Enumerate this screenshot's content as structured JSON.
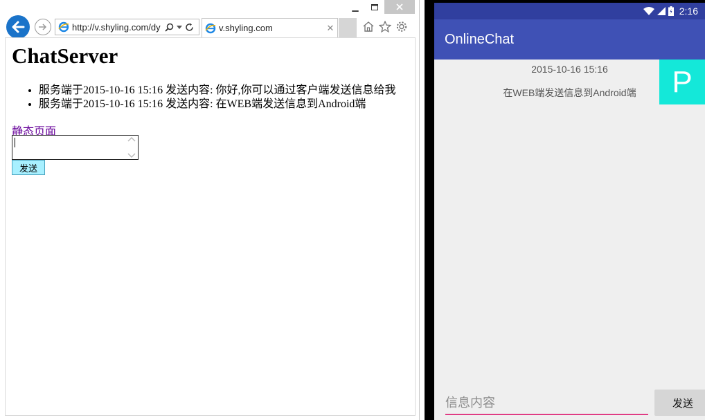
{
  "browser": {
    "address": "http://v.shyling.com/dy",
    "tab_title": "v.shyling.com",
    "page": {
      "title": "ChatServer",
      "messages": [
        "服务端于2015-10-16 15:16 发送内容: 你好,你可以通过客户端发送信息给我",
        "服务端于2015-10-16 15:16 发送内容: 在WEB端发送信息到Android端"
      ],
      "link_label": "静态页面",
      "send_label": "发送"
    }
  },
  "android": {
    "time": "2:16",
    "app_title": "OnlineChat",
    "message": {
      "timestamp": "2015-10-16 15:16",
      "text": "在WEB端发送信息到Android端",
      "avatar_letter": "P"
    },
    "input_placeholder": "信息内容",
    "send_label": "发送",
    "colors": {
      "primary": "#3f51b5",
      "primary_dark": "#303f9f",
      "accent": "#e03c84",
      "avatar": "#14e8d9"
    }
  }
}
